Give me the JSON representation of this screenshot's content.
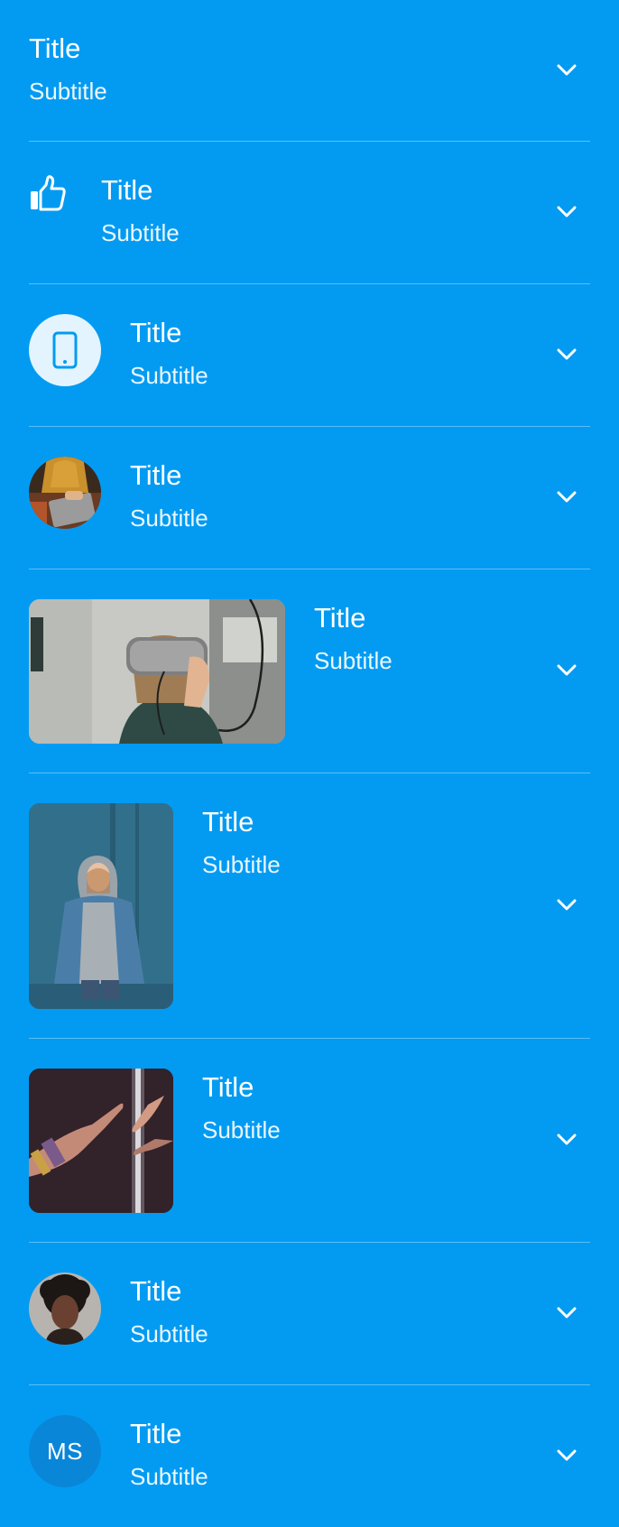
{
  "theme": {
    "background": "#039BF2",
    "text": "#FFFFFF",
    "divider": "rgba(255,255,255,0.35)",
    "icon_bubble": "#E3F4FE",
    "initials_bubble": "#0A86D8"
  },
  "items": [
    {
      "title": "Title",
      "subtitle": "Subtitle",
      "leading": "none",
      "trailing": "chevron-down-icon"
    },
    {
      "title": "Title",
      "subtitle": "Subtitle",
      "leading": "thumbs-up-icon",
      "trailing": "chevron-down-icon"
    },
    {
      "title": "Title",
      "subtitle": "Subtitle",
      "leading": "smartphone-icon",
      "trailing": "chevron-down-icon"
    },
    {
      "title": "Title",
      "subtitle": "Subtitle",
      "leading": "avatar-photo",
      "trailing": "chevron-down-icon"
    },
    {
      "title": "Title",
      "subtitle": "Subtitle",
      "leading": "wide-photo",
      "trailing": "chevron-down-icon"
    },
    {
      "title": "Title",
      "subtitle": "Subtitle",
      "leading": "tall-photo",
      "trailing": "chevron-down-icon"
    },
    {
      "title": "Title",
      "subtitle": "Subtitle",
      "leading": "square-photo",
      "trailing": "chevron-down-icon"
    },
    {
      "title": "Title",
      "subtitle": "Subtitle",
      "leading": "avatar-photo",
      "trailing": "chevron-down-icon"
    },
    {
      "title": "Title",
      "subtitle": "Subtitle",
      "leading": "initials",
      "initials": "MS",
      "trailing": "chevron-down-icon"
    }
  ]
}
